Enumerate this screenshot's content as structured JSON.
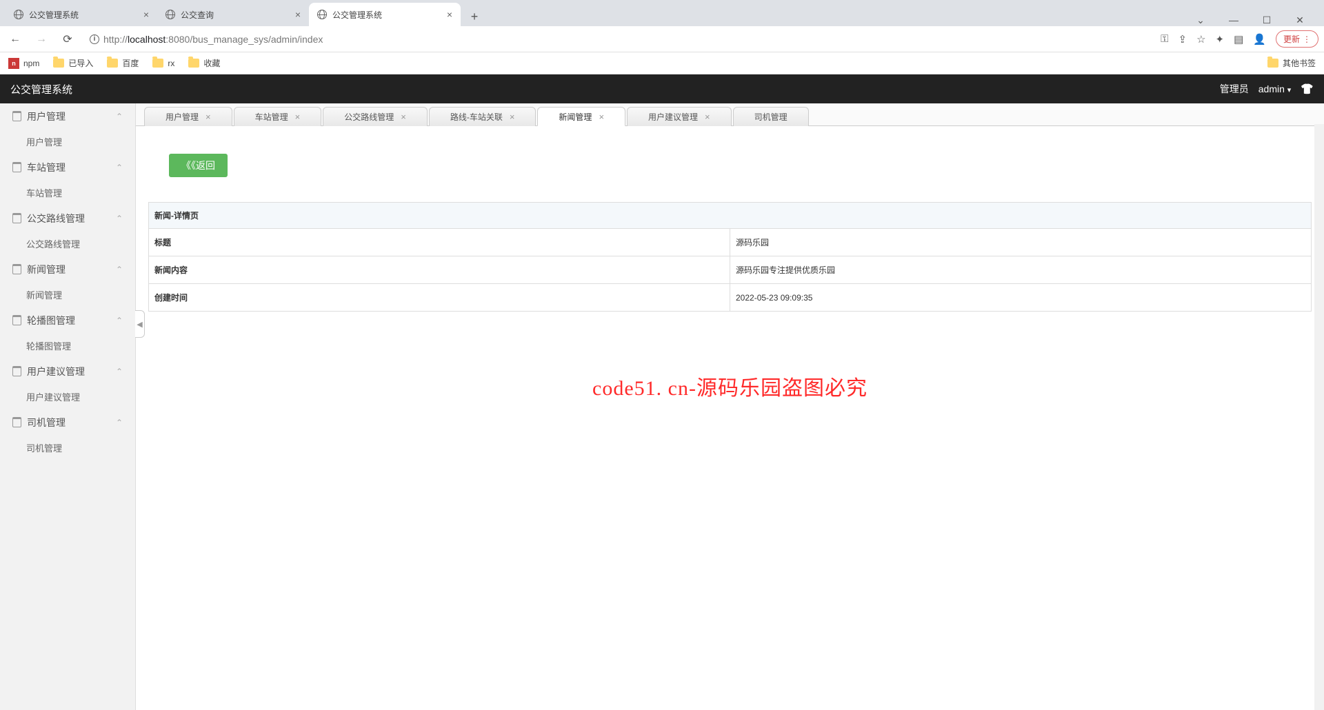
{
  "browser": {
    "tabs": [
      {
        "title": "公交管理系统",
        "active": false
      },
      {
        "title": "公交查询",
        "active": false
      },
      {
        "title": "公交管理系统",
        "active": true
      }
    ],
    "url_host": "localhost",
    "url_port": ":8080",
    "url_path": "/bus_manage_sys/admin/index",
    "url_prefix": "http://",
    "update_label": "更新",
    "bookmarks": [
      {
        "label": "npm",
        "type": "npm"
      },
      {
        "label": "已导入",
        "type": "folder"
      },
      {
        "label": "百度",
        "type": "folder"
      },
      {
        "label": "rx",
        "type": "folder"
      },
      {
        "label": "收藏",
        "type": "folder"
      }
    ],
    "other_bookmarks": "其他书签"
  },
  "app": {
    "title": "公交管理系统",
    "role_label": "管理员",
    "user": "admin"
  },
  "sidebar": [
    {
      "label": "用户管理",
      "children": [
        "用户管理"
      ]
    },
    {
      "label": "车站管理",
      "children": [
        "车站管理"
      ]
    },
    {
      "label": "公交路线管理",
      "children": [
        "公交路线管理"
      ]
    },
    {
      "label": "新闻管理",
      "children": [
        "新闻管理"
      ]
    },
    {
      "label": "轮播图管理",
      "children": [
        "轮播图管理"
      ]
    },
    {
      "label": "用户建议管理",
      "children": [
        "用户建议管理"
      ]
    },
    {
      "label": "司机管理",
      "children": [
        "司机管理"
      ]
    }
  ],
  "content_tabs": [
    {
      "label": "用户管理",
      "closable": true,
      "active": false
    },
    {
      "label": "车站管理",
      "closable": true,
      "active": false
    },
    {
      "label": "公交路线管理",
      "closable": true,
      "active": false
    },
    {
      "label": "路线-车站关联",
      "closable": true,
      "active": false
    },
    {
      "label": "新闻管理",
      "closable": true,
      "active": true
    },
    {
      "label": "用户建议管理",
      "closable": true,
      "active": false
    },
    {
      "label": "司机管理",
      "closable": false,
      "active": false
    }
  ],
  "back_button": "《《返回",
  "detail": {
    "heading": "新闻-详情页",
    "rows": [
      {
        "label": "标题",
        "value": "源码乐园"
      },
      {
        "label": "新闻内容",
        "value": "源码乐园专注提供优质乐园"
      },
      {
        "label": "创建时间",
        "value": "2022-05-23 09:09:35"
      }
    ]
  },
  "watermark": "code51. cn-源码乐园盗图必究"
}
